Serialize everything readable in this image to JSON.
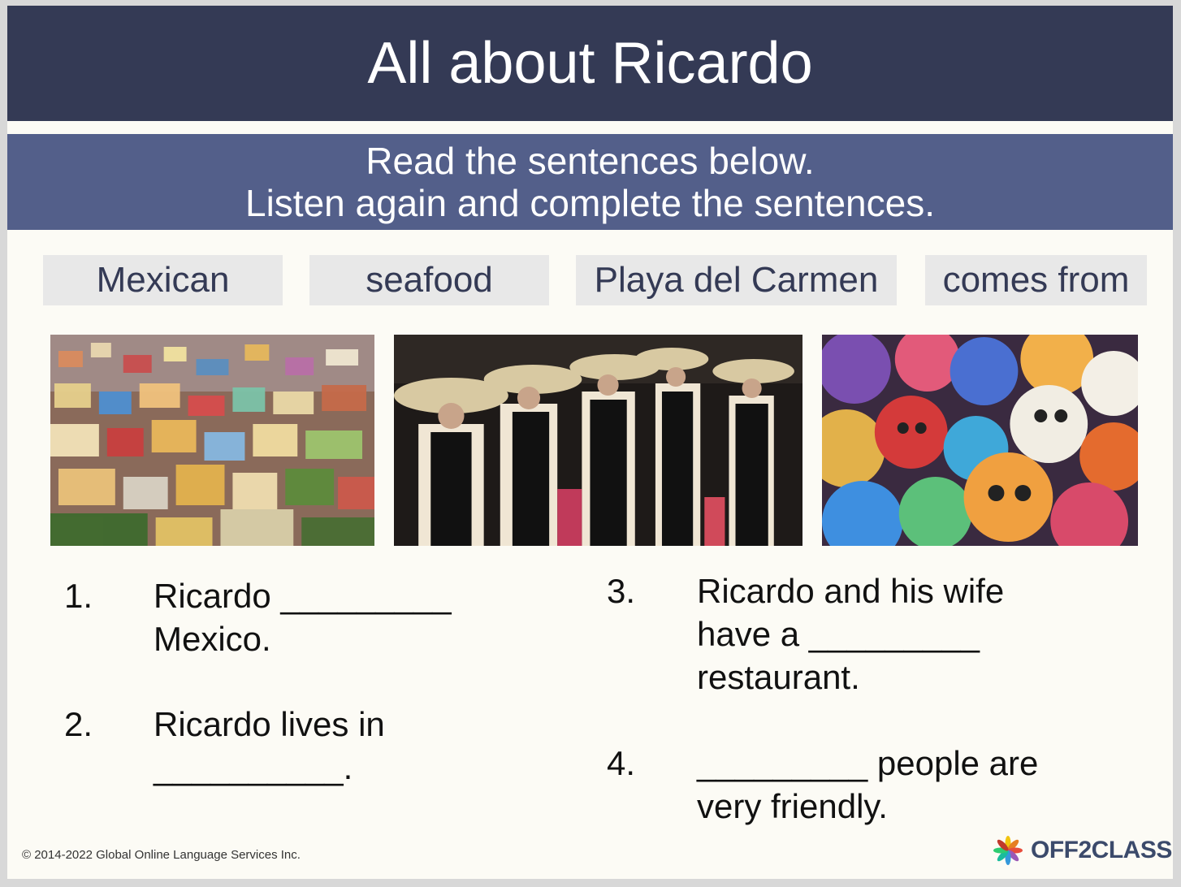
{
  "title": "All about Ricardo",
  "instructions": {
    "line1": "Read the sentences below.",
    "line2": "Listen again and complete the sentences."
  },
  "word_bank": [
    "Mexican",
    "seafood",
    "Playa del Carmen",
    "comes from"
  ],
  "photos": [
    "colorful-town-photo",
    "mariachi-dancers-photo",
    "sugar-skulls-photo"
  ],
  "sentences": [
    {
      "number": "1.",
      "lines": [
        "Ricardo _________",
        "Mexico."
      ]
    },
    {
      "number": "2.",
      "lines": [
        "Ricardo lives in",
        "__________."
      ]
    },
    {
      "number": "3.",
      "lines": [
        "Ricardo and his wife",
        "have a _________",
        "restaurant."
      ]
    },
    {
      "number": "4.",
      "lines": [
        "_________ people are",
        "very friendly."
      ]
    }
  ],
  "footer": "© 2014-2022 Global Online Language Services Inc.",
  "logo": "OFF2CLASS",
  "colors": {
    "title_bar": "#343a55",
    "instruction_bar": "#535f8a",
    "word_box": "#e8e8e8"
  }
}
